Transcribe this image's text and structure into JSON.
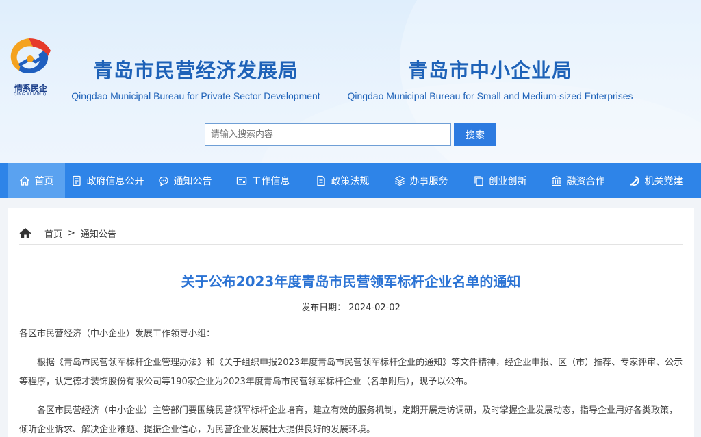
{
  "header": {
    "logo": {
      "text": "情系民企",
      "subtext": "QING XI MIN QI",
      "icon": "logo-emblem"
    },
    "orgs": [
      {
        "cn": "青岛市民营经济发展局",
        "en": "Qingdao Municipal Bureau for Private Sector Development"
      },
      {
        "cn": "青岛市中小企业局",
        "en": "Qingdao Municipal Bureau for Small and Medium-sized Enterprises"
      }
    ],
    "search": {
      "placeholder": "请输入搜索内容",
      "value": "",
      "button": "搜索"
    }
  },
  "nav": {
    "items": [
      {
        "label": "首页",
        "icon": "home-icon",
        "active": true
      },
      {
        "label": "政府信息公开",
        "icon": "document-icon"
      },
      {
        "label": "通知公告",
        "icon": "chat-icon"
      },
      {
        "label": "工作信息",
        "icon": "card-icon"
      },
      {
        "label": "政策法规",
        "icon": "file-icon"
      },
      {
        "label": "办事服务",
        "icon": "layers-icon"
      },
      {
        "label": "创业创新",
        "icon": "copy-icon"
      },
      {
        "label": "融资合作",
        "icon": "building-icon"
      },
      {
        "label": "机关党建",
        "icon": "party-emblem-icon"
      }
    ]
  },
  "breadcrumb": {
    "home": "首页",
    "separator": ">",
    "current": "通知公告"
  },
  "article": {
    "title": "关于公布2023年度青岛市民营领军标杆企业名单的通知",
    "date_label": "发布日期：",
    "date": "2024-02-02",
    "paragraphs": [
      "各区市民营经济（中小企业）发展工作领导小组：",
      "根据《青岛市民营领军标杆企业管理办法》和《关于组织申报2023年度青岛市民营领军标杆企业的通知》等文件精神，经企业申报、区（市）推荐、专家评审、公示等程序，认定德才装饰股份有限公司等190家企业为2023年度青岛市民营领军标杆企业（名单附后），现予以公布。",
      "各区市民营经济（中小企业）主管部门要围绕民营领军标杆企业培育，建立有效的服务机制，定期开展走访调研，及时掌握企业发展动态，指导企业用好各类政策，倾听企业诉求、解决企业难题、提振企业信心，为民营企业发展壮大提供良好的发展环境。"
    ]
  },
  "colors": {
    "nav_bg": "#2e84e8",
    "nav_active": "#5aa2f0",
    "title": "#2b73d4",
    "org_text": "#1e62b8"
  }
}
